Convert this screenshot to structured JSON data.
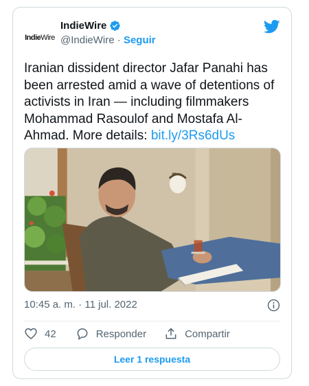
{
  "author": {
    "logo_text_bold": "Indie",
    "logo_text_thin": "Wire",
    "name": "IndieWire",
    "handle": "@IndieWire",
    "separator": "·",
    "follow_label": "Seguir"
  },
  "tweet": {
    "text": "Iranian dissident director Jafar Panahi has been arrested amid a wave of detentions of activists in Iran — including filmmakers Mohammad Rasoulof and Mostafa Al-Ahmad. More details: ",
    "link": "bit.ly/3Rs6dUs",
    "timestamp": "10:45 a. m. · 11 jul. 2022"
  },
  "actions": {
    "likes": "42",
    "reply_label": "Responder",
    "share_label": "Compartir",
    "read_replies_label": "Leer 1 respuesta"
  },
  "colors": {
    "accent": "#1d9bf0",
    "text": "#0f1419",
    "muted": "#536471",
    "border": "#cfd9de"
  },
  "icons": [
    "verified-badge-icon",
    "twitter-bird-icon",
    "info-icon",
    "heart-icon",
    "reply-icon",
    "share-icon"
  ]
}
